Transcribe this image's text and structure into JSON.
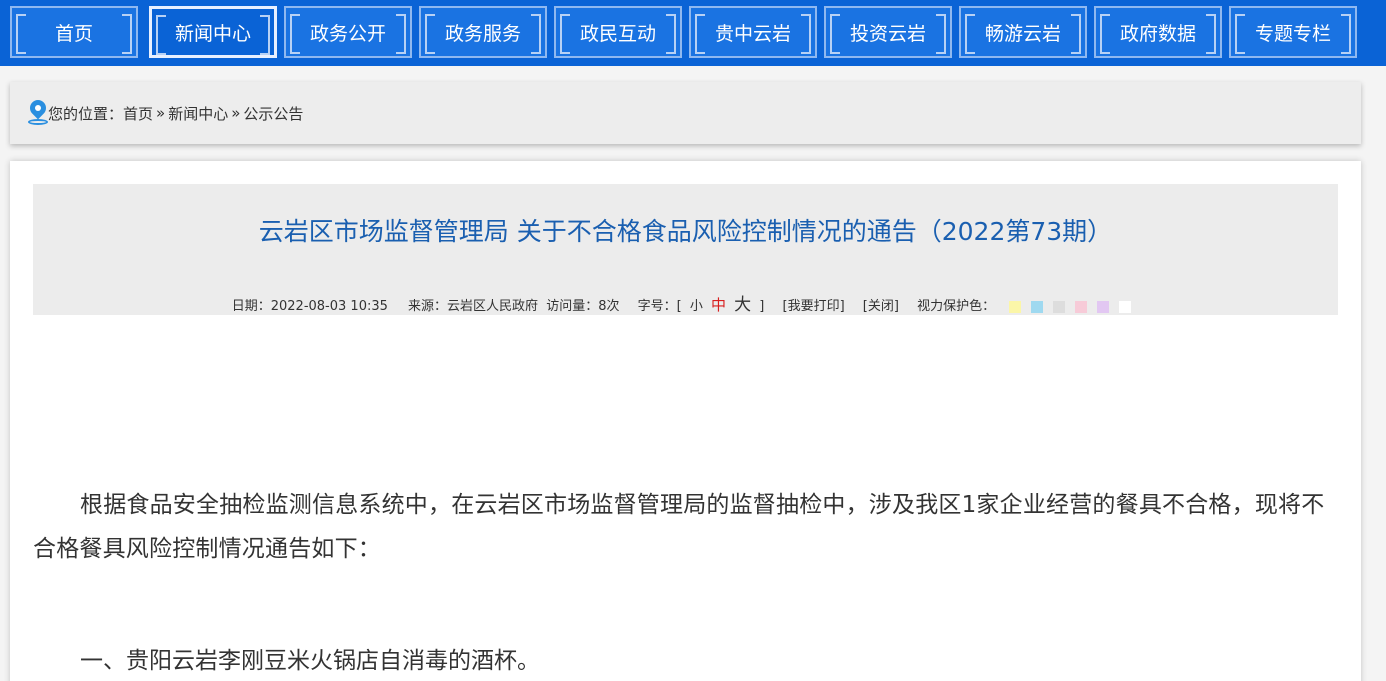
{
  "nav": {
    "items": [
      {
        "label": "首页",
        "active": false
      },
      {
        "label": "新闻中心",
        "active": true
      },
      {
        "label": "政务公开",
        "active": false
      },
      {
        "label": "政务服务",
        "active": false
      },
      {
        "label": "政民互动",
        "active": false
      },
      {
        "label": "贵中云岩",
        "active": false
      },
      {
        "label": "投资云岩",
        "active": false
      },
      {
        "label": "畅游云岩",
        "active": false
      },
      {
        "label": "政府数据",
        "active": false
      },
      {
        "label": "专题专栏",
        "active": false
      }
    ]
  },
  "breadcrumb": {
    "prefix": "您的位置：",
    "home": "首页",
    "sep1": "»",
    "section": "新闻中心",
    "sep2": "»",
    "current": "公示公告"
  },
  "article": {
    "title": "云岩区市场监督管理局 关于不合格食品风险控制情况的通告（2022第73期）",
    "meta": {
      "date": "日期：2022-08-03 10:35",
      "source": "来源：云岩区人民政府",
      "views": "访问量：8次",
      "font_label": "字号：[",
      "font_small": "小",
      "font_mid": "中",
      "font_big": "大",
      "font_close": "]",
      "print": "[我要打印]",
      "close": "[关闭]",
      "eye_label": "视力保护色："
    },
    "eye_colors": [
      "#fbf6a8",
      "#9fd9f0",
      "#dddddd",
      "#f7cbd8",
      "#e2c7f2",
      "#ffffff"
    ],
    "paragraph1": "根据食品安全抽检监测信息系统中，在云岩区市场监督管理局的监督抽检中，涉及我区1家企业经营的餐具不合格，现将不合格餐具风险控制情况通告如下：",
    "paragraph2": "一、贵阳云岩李刚豆米火锅店自消毒的酒杯。"
  }
}
